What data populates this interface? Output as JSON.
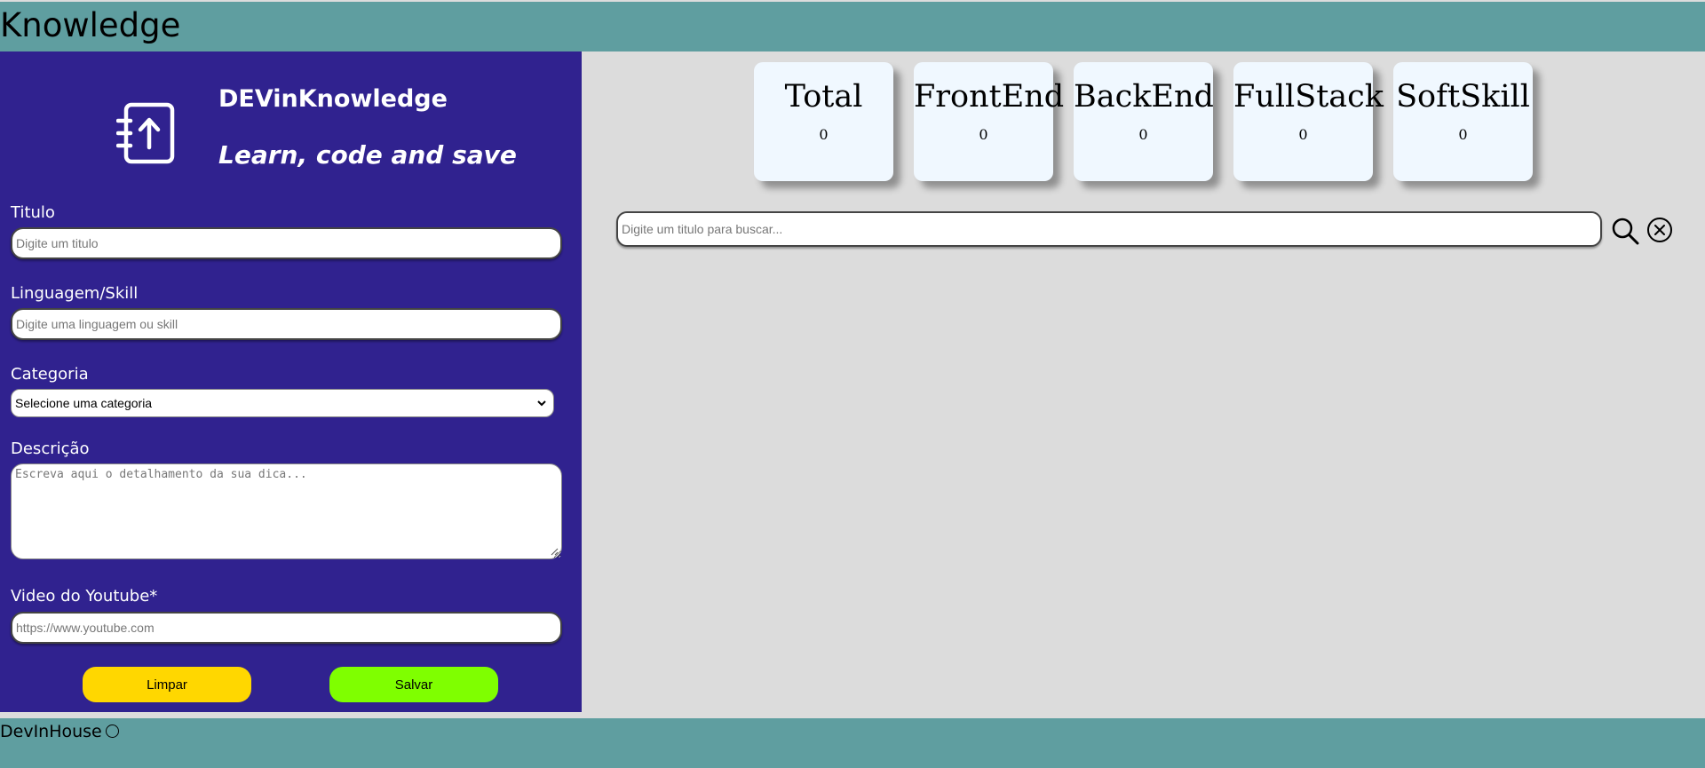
{
  "header": {
    "title": "Knowledge"
  },
  "sidebar": {
    "brand_name": "DEVinKnowledge",
    "tagline": "Learn, code and save",
    "logo_icon": "upload-notebook-icon",
    "fields": {
      "titulo": {
        "label": "Titulo",
        "placeholder": "Digite um titulo",
        "value": ""
      },
      "linguagem": {
        "label": "Linguagem/Skill",
        "placeholder": "Digite uma linguagem ou skill",
        "value": ""
      },
      "categoria": {
        "label": "Categoria",
        "selected": "Selecione uma categoria"
      },
      "descricao": {
        "label": "Descrição",
        "placeholder": "Escreva aqui o detalhamento da sua dica...",
        "value": ""
      },
      "video": {
        "label": "Video do Youtube*",
        "placeholder": "https://www.youtube.com",
        "value": ""
      }
    },
    "buttons": {
      "clear": "Limpar",
      "save": "Salvar"
    }
  },
  "stats": [
    {
      "label": "Total",
      "count": "0"
    },
    {
      "label": "FrontEnd",
      "count": "0"
    },
    {
      "label": "BackEnd",
      "count": "0"
    },
    {
      "label": "FullStack",
      "count": "0"
    },
    {
      "label": "SoftSkill",
      "count": "0"
    }
  ],
  "search": {
    "placeholder": "Digite um titulo para buscar...",
    "value": "",
    "search_icon": "magnifier-icon",
    "clear_icon": "close-circle-icon"
  },
  "footer": {
    "text": "DevInHouse"
  },
  "colors": {
    "header_bg": "#5f9ea0",
    "sidebar_bg": "#30228f",
    "main_bg": "#dcdcdc",
    "card_bg": "#f0f8ff",
    "clear_button": "#ffd700",
    "save_button": "#7fff00"
  }
}
